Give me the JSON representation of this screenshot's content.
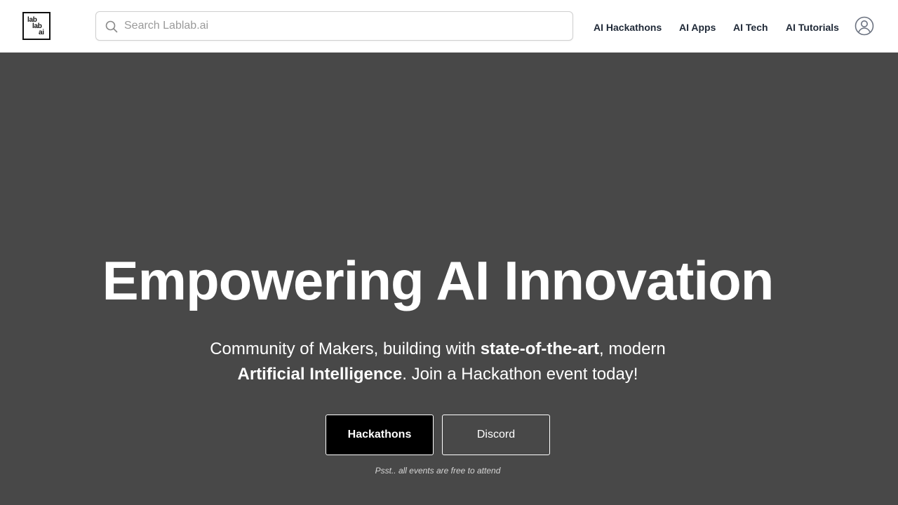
{
  "header": {
    "logo": {
      "line1": "lab",
      "line2": "lab",
      "line3": "ai"
    },
    "search": {
      "placeholder": "Search Lablab.ai",
      "value": ""
    },
    "nav": [
      {
        "label": "AI Hackathons"
      },
      {
        "label": "AI Apps"
      },
      {
        "label": "AI Tech"
      },
      {
        "label": "AI Tutorials"
      }
    ],
    "user_icon": "user-circle-icon",
    "search_icon": "search-icon"
  },
  "hero": {
    "title": "Empowering AI Innovation",
    "subtitle": {
      "part1": "Community of Makers, building with ",
      "bold1": "state-of-the-art",
      "part2": ", modern ",
      "bold2": "Artificial Intelligence",
      "part3": ". Join a Hackathon event today!"
    },
    "buttons": {
      "primary": "Hackathons",
      "secondary": "Discord"
    },
    "note": "Psst.. all events are free to attend"
  },
  "colors": {
    "header_bg": "#ffffff",
    "hero_bg": "#484848",
    "primary_button": "#000000",
    "text_light": "#ffffff"
  }
}
